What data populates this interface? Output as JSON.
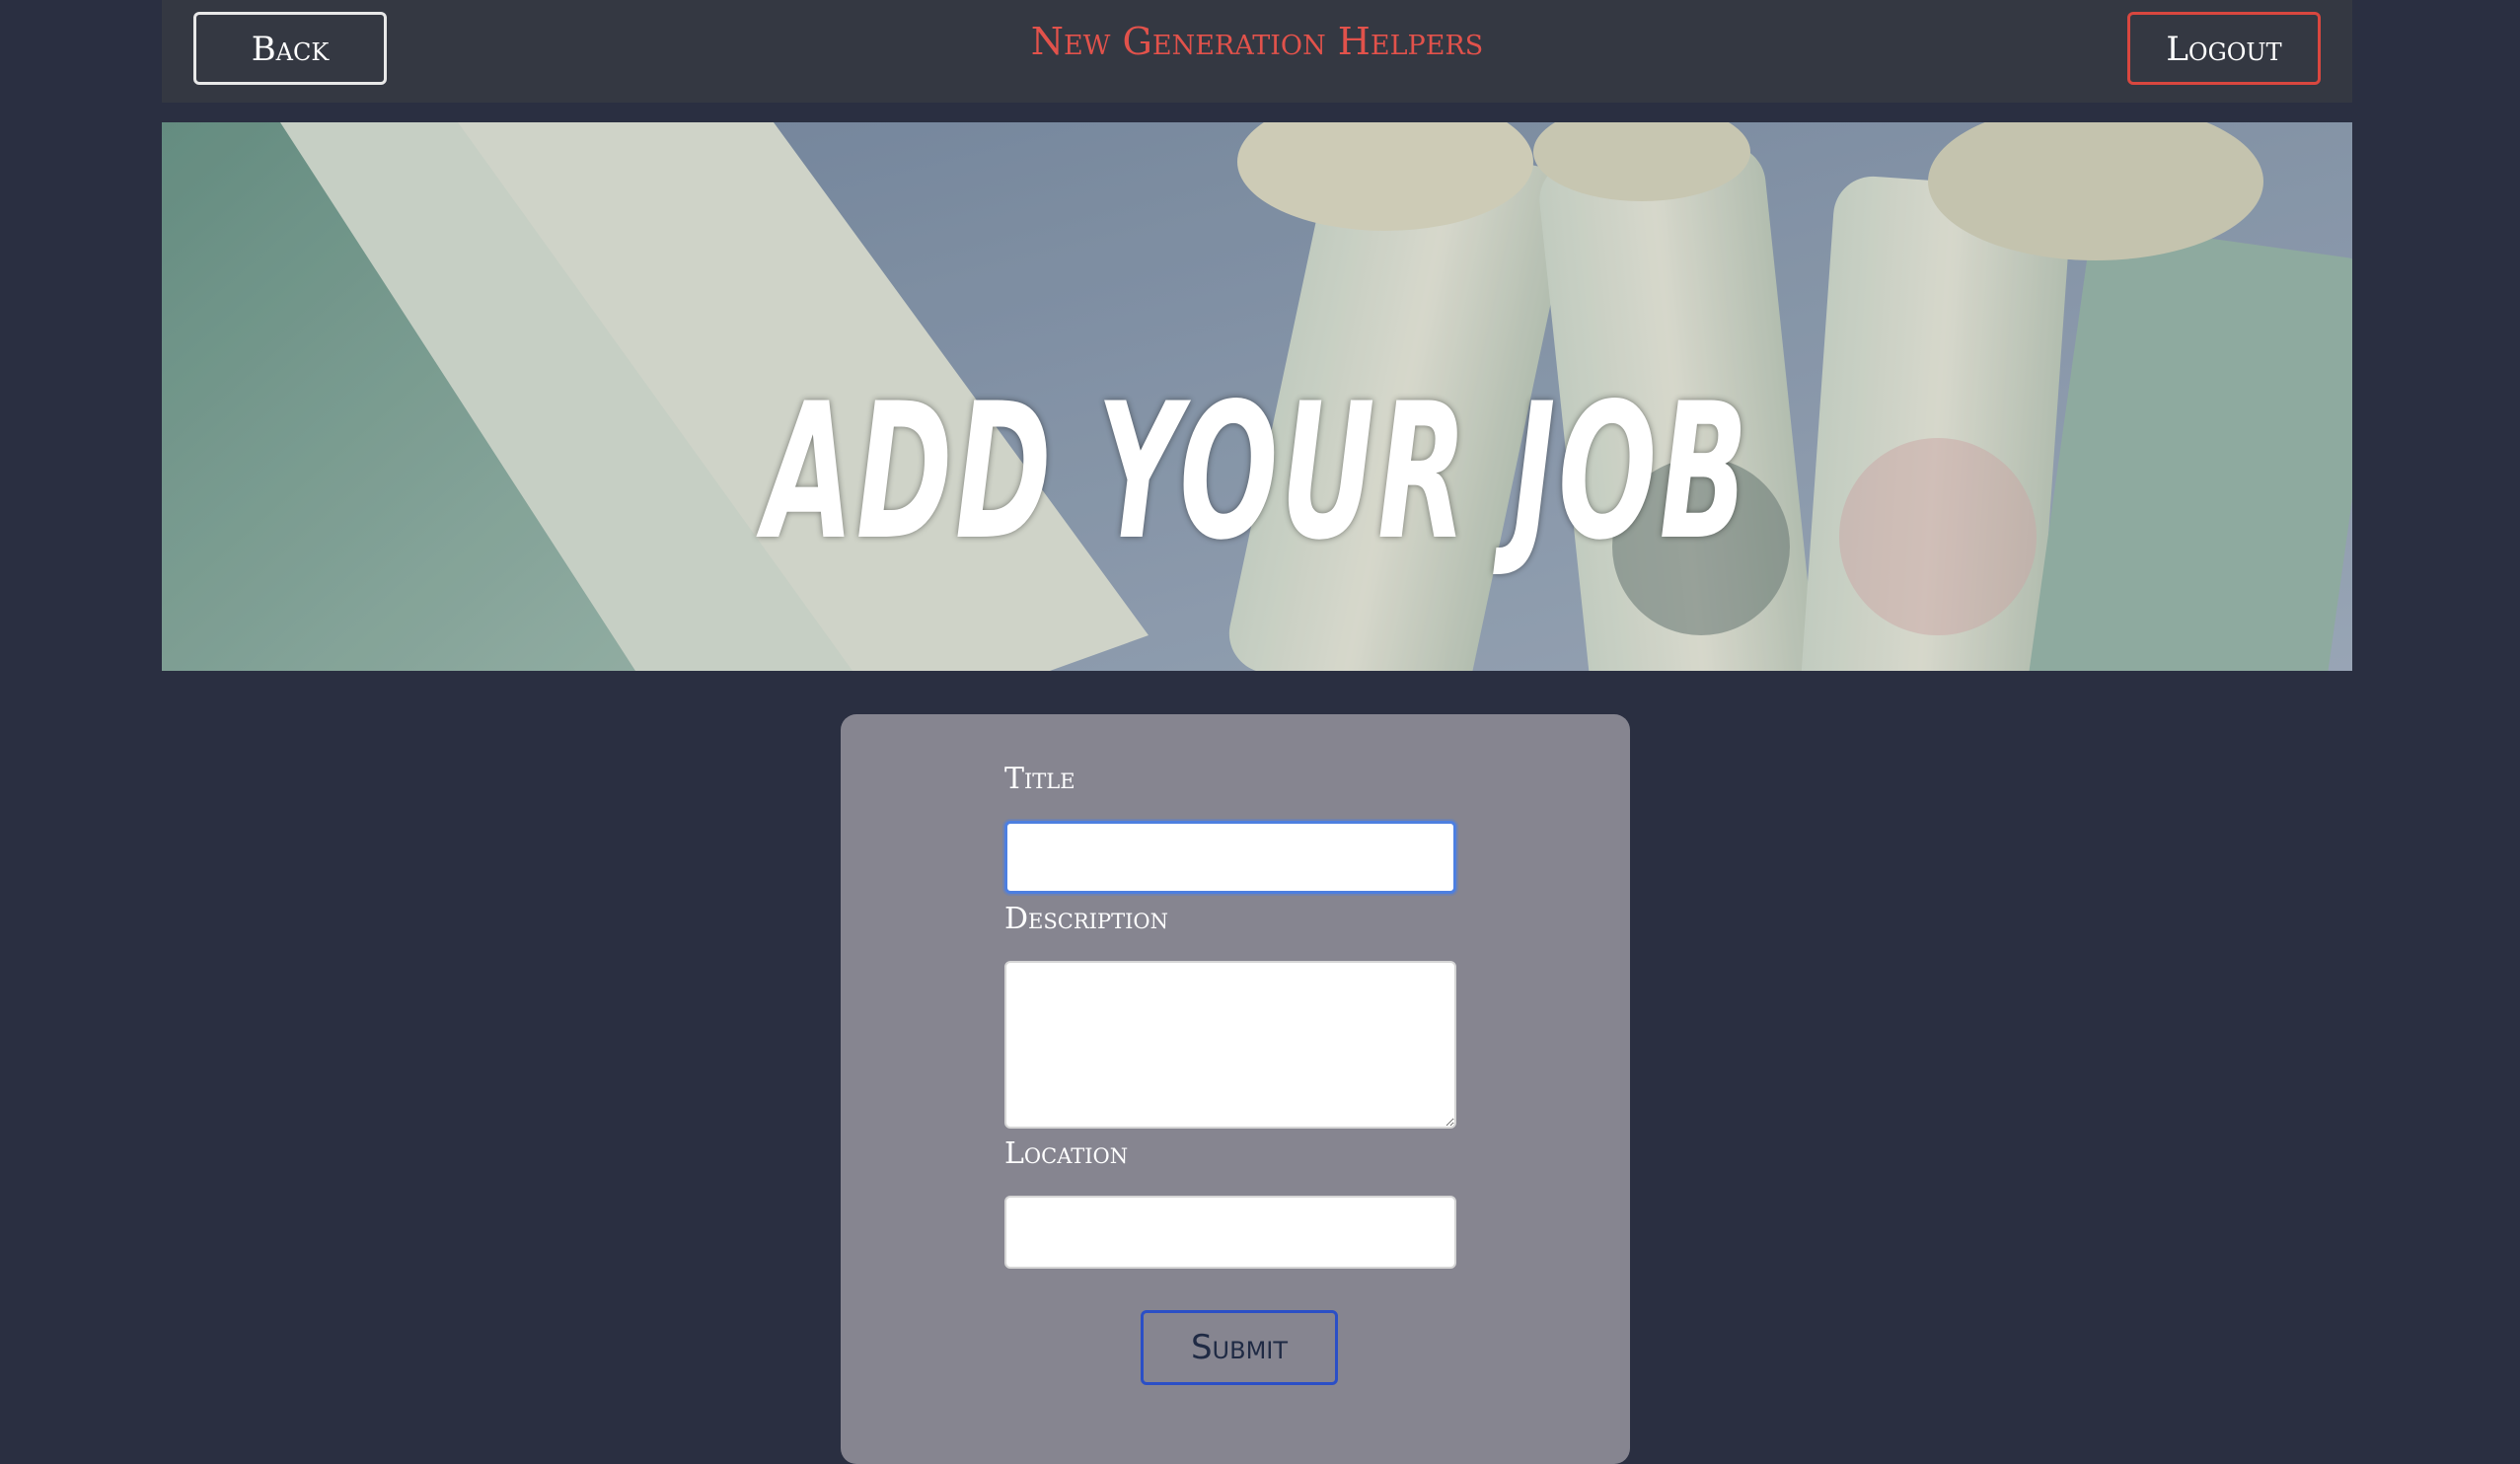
{
  "navbar": {
    "back_label": "Back",
    "brand": "New Generation Helpers",
    "logout_label": "Logout"
  },
  "hero": {
    "title": "ADD YOUR JOB"
  },
  "form": {
    "title_label": "Title",
    "title_value": "",
    "description_label": "Description",
    "description_value": "",
    "location_label": "Location",
    "location_value": "",
    "submit_label": "Submit"
  },
  "colors": {
    "background": "#2a2f41",
    "navbar": "#343842",
    "brand": "#e2524b",
    "logout_border": "#d9473f",
    "form_card": "#868590",
    "focus": "#4d7fe0",
    "submit_border": "#2b4fc6"
  }
}
